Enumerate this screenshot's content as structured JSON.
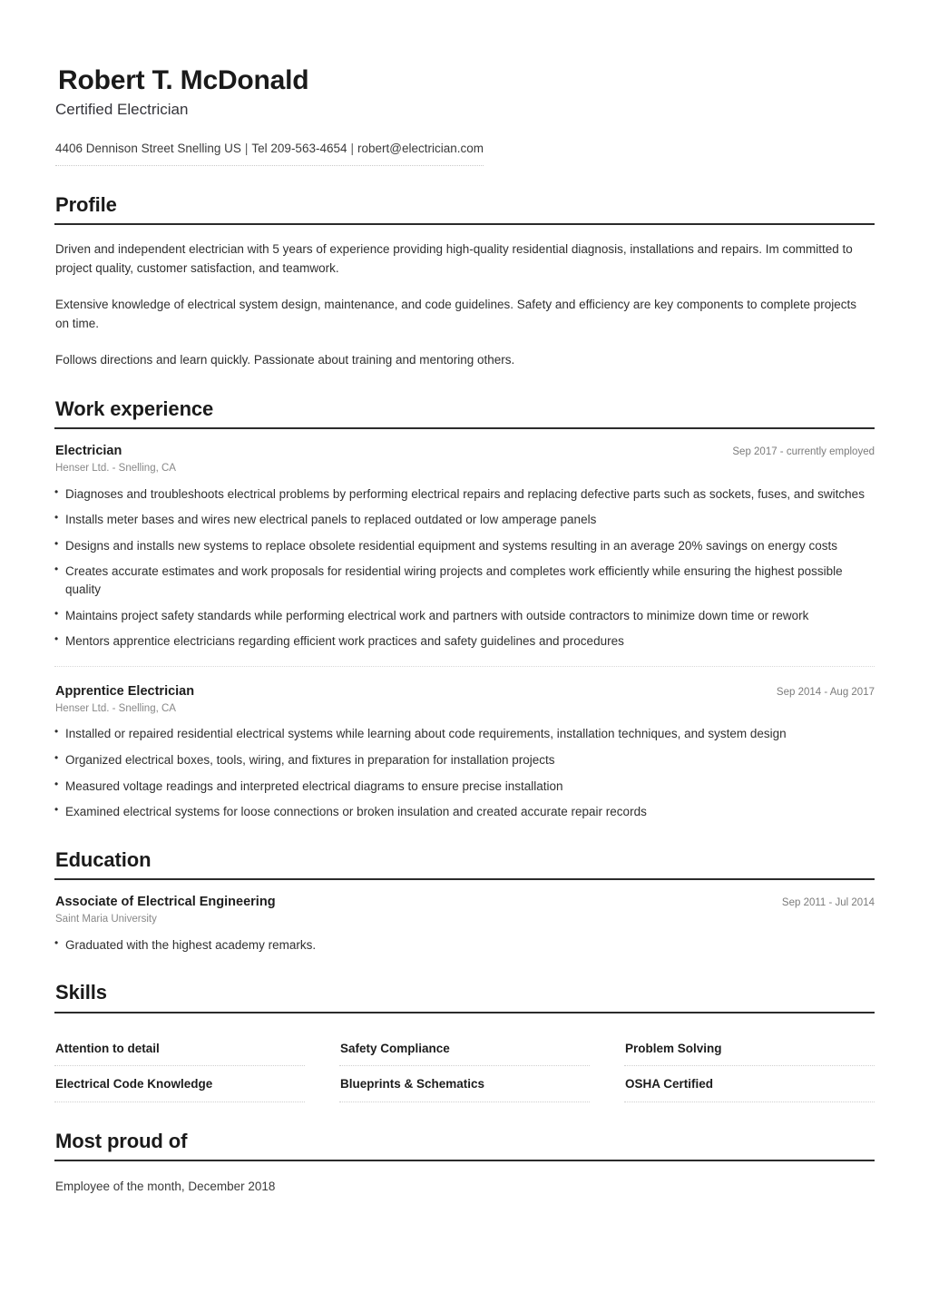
{
  "header": {
    "name": "Robert T. McDonald",
    "title": "Certified Electrician",
    "contact": {
      "address": "4406 Dennison Street Snelling US",
      "separator": "|",
      "phone": "Tel 209-563-4654",
      "email": "robert@electrician.com"
    }
  },
  "sections": {
    "profile": {
      "heading": "Profile",
      "paragraphs": [
        "Driven and independent electrician with 5 years of experience providing high-quality residential diagnosis, installations and repairs. Im committed to project quality, customer satisfaction, and teamwork.",
        "Extensive knowledge of electrical system design, maintenance, and code guidelines. Safety and efficiency are key components to complete projects on time.",
        "Follows directions and learn quickly. Passionate about training and mentoring others."
      ]
    },
    "work_experience": {
      "heading": "Work experience",
      "entries": [
        {
          "role": "Electrician",
          "organization": "Henser Ltd. - Snelling, CA",
          "date": "Sep 2017 - currently employed",
          "bullets": [
            "Diagnoses and troubleshoots electrical problems by performing electrical repairs and replacing defective parts such as sockets, fuses, and switches",
            "Installs meter bases and wires new electrical panels to replaced outdated or low amperage panels",
            "Designs and installs new systems to replace obsolete residential equipment and systems resulting in an average 20% savings on energy costs",
            "Creates accurate estimates and work proposals for residential wiring projects and completes work efficiently while ensuring the highest possible quality",
            "Maintains project safety standards while performing electrical work and partners with outside contractors to minimize down time or rework",
            "Mentors apprentice electricians regarding efficient work practices and safety guidelines and procedures"
          ]
        },
        {
          "role": "Apprentice Electrician",
          "organization": "Henser Ltd. - Snelling, CA",
          "date": "Sep 2014 - Aug 2017",
          "bullets": [
            "Installed or repaired residential electrical systems while learning about code requirements, installation techniques, and system design",
            "Organized electrical boxes, tools, wiring, and fixtures in preparation for installation projects",
            "Measured voltage readings and interpreted electrical diagrams to ensure precise installation",
            "Examined electrical systems for loose connections or broken insulation and created accurate repair records"
          ]
        }
      ]
    },
    "education": {
      "heading": "Education",
      "entries": [
        {
          "role": "Associate of Electrical Engineering",
          "organization": "Saint Maria University",
          "date": "Sep 2011 - Jul 2014",
          "bullets": [
            "Graduated with the highest academy remarks."
          ]
        }
      ]
    },
    "skills": {
      "heading": "Skills",
      "items": [
        "Attention to detail",
        "Safety Compliance",
        "Problem Solving",
        "Electrical Code Knowledge",
        "Blueprints & Schematics",
        "OSHA Certified"
      ]
    },
    "most_proud_of": {
      "heading": "Most proud of",
      "text": "Employee of the month, December 2018"
    }
  },
  "colors": {
    "text": "#2d2d2d",
    "heading": "#1a1a1a",
    "muted": "#888888",
    "rule": "#2b2b2b",
    "dotted": "#cfcfcf",
    "background": "#ffffff"
  }
}
